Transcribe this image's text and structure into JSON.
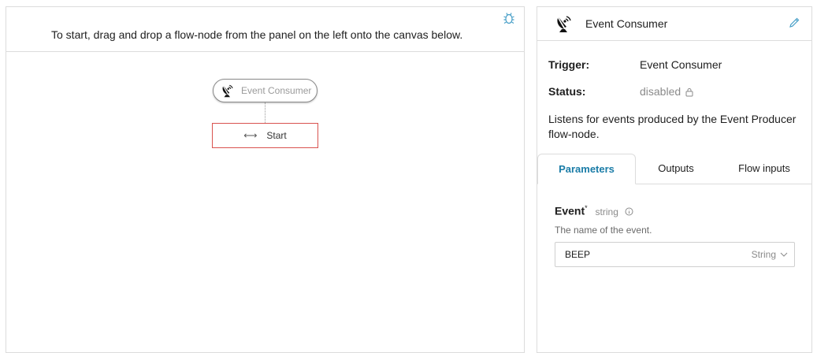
{
  "canvas": {
    "hint": "To start, drag and drop a flow-node from the panel on the left onto the canvas below.",
    "debug_icon": "bug-icon",
    "trigger_node": {
      "label": "Event Consumer",
      "icon": "satellite-dish-icon"
    },
    "start_node": {
      "label": "Start",
      "icon": "double-arrow-icon"
    }
  },
  "side_panel": {
    "title": "Event Consumer",
    "title_icon": "satellite-dish-icon",
    "edit_icon": "pencil-icon",
    "properties": {
      "trigger_label": "Trigger:",
      "trigger_value": "Event Consumer",
      "status_label": "Status:",
      "status_value": "disabled",
      "status_icon": "lock-icon"
    },
    "description": "Listens for events produced by the Event Producer flow-node.",
    "tabs": [
      {
        "label": "Parameters",
        "active": true
      },
      {
        "label": "Outputs",
        "active": false
      },
      {
        "label": "Flow inputs",
        "active": false
      }
    ],
    "parameter": {
      "name": "Event",
      "required_mark": "*",
      "type": "string",
      "info_icon": "info-icon",
      "description": "The name of the event.",
      "value": "BEEP",
      "value_type": "String",
      "dropdown_icon": "chevron-down-icon"
    }
  },
  "colors": {
    "accent": "#1a7ca7",
    "error_border": "#d9534f",
    "border": "#dcdcdc",
    "muted": "#8a8a8a"
  }
}
